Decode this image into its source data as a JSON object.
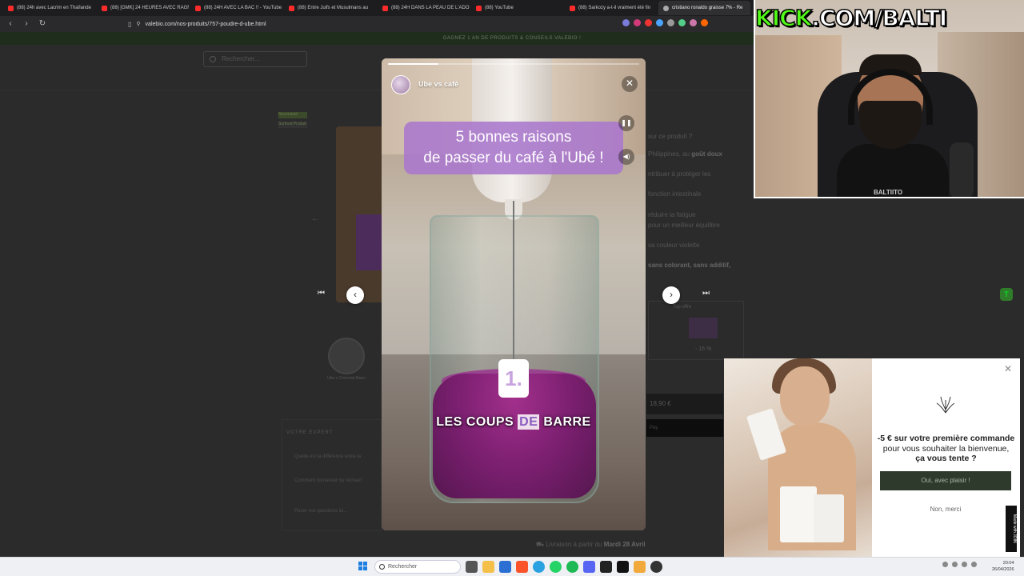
{
  "browser": {
    "tabs": [
      {
        "title": "(88) 24h avec Lacrim en Thaïlande",
        "icon": "youtube-icon",
        "active": false
      },
      {
        "title": "(88) [GMK] 24 HEURES AVEC RAGN",
        "icon": "youtube-icon",
        "active": false
      },
      {
        "title": "(88) 24H AVEC LA BAC !! - YouTube",
        "icon": "youtube-icon",
        "active": false
      },
      {
        "title": "(88) Entre Juifs et Musulmans au",
        "icon": "youtube-icon",
        "active": false
      },
      {
        "title": "(88) 24H DANS LA PEAU DE L'ADO",
        "icon": "youtube-icon",
        "active": false
      },
      {
        "title": "(88) YouTube",
        "icon": "youtube-icon",
        "active": false
      },
      {
        "title": "(88) Sarkozy a-t-il vraiment été fin",
        "icon": "youtube-icon",
        "active": false
      },
      {
        "title": "cristiano ronaldo graisse 7% - Re",
        "icon": "globe-icon",
        "active": true
      }
    ],
    "url": "valebio.com/nos-produits/757-poudre-d-ube.html"
  },
  "site": {
    "promo": "GAGNEZ 1 AN DE PRODUITS & CONSEILS VALEBIO !",
    "search_placeholder": "Rechercher...",
    "badges": [
      "Nouveauté",
      "Surfood Produit"
    ],
    "thumb_label": "Ube x Chocolat Maori",
    "side_lines": [
      {
        "text": "sur ce produit ?",
        "bold": ""
      },
      {
        "text": "Philippines, au ",
        "bold": "goût doux"
      },
      {
        "text": "ntribuer à protéger les",
        "bold": ""
      },
      {
        "text": "fonction intestinale",
        "bold": ""
      },
      {
        "text": "réduire la fatigue",
        "bold": ""
      },
      {
        "text": "pour un meilleur équilibre",
        "bold": ""
      },
      {
        "text": "sa couleur violette",
        "bold": ""
      },
      {
        "text": "",
        "bold": "sans colorant, sans additif,"
      }
    ],
    "offer_label": "Top offre",
    "offer_discount": "- 15 %",
    "price": "18,90 €",
    "pay_label": "Pay",
    "faq_title": "VOTRE EXPERT",
    "faq_items": [
      "Quelle est la différence entre la",
      "Comment conserver ou réchauf",
      "Poser vos questions ici..."
    ],
    "delivery_prefix": "Livraison à partir du ",
    "delivery_date": "Mardi 28 Avril",
    "fab_label": "T"
  },
  "story": {
    "title": "Ube vs café",
    "headline_line1": "5 bonnes raisons",
    "headline_line2": "de passer du café à l'Ubé !",
    "number": "1.",
    "caption_before": "LES COUPS ",
    "caption_highlight": "DE",
    "caption_after": " BARRE",
    "progress": 0.2,
    "icons": {
      "close": "close-icon",
      "pause": "pause-icon",
      "sound": "sound-icon",
      "prev": "chevron-left-icon",
      "next": "chevron-right-icon"
    }
  },
  "popup": {
    "title": "-5 € sur votre première commande",
    "subtitle": "pour vous souhaiter la bienvenue,",
    "question": "ça vous tente ?",
    "accept": "Oui, avec plaisir !",
    "decline": "Non, merci",
    "badge": "Made with JOIN"
  },
  "stream": {
    "kick_brand": "KICK",
    "kick_rest": ".COM/BALTI",
    "shirt_text": "BALTIITO"
  },
  "taskbar": {
    "search_placeholder": "Rechercher",
    "time": "20:04",
    "date": "26/04/2026"
  },
  "colors": {
    "accent_purple": "#aa78cd",
    "kick_green": "#53fc18",
    "brand_green": "#2e3b2c"
  }
}
